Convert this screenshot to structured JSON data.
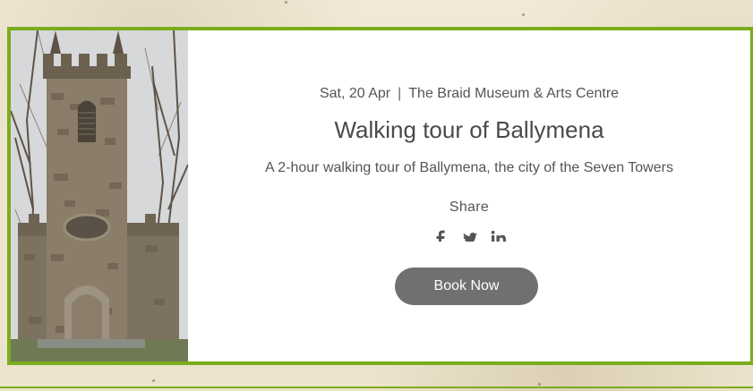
{
  "event": {
    "date": "Sat, 20 Apr",
    "separator": "|",
    "venue": "The Braid Museum & Arts Centre",
    "title": "Walking tour of Ballymena",
    "description": "A 2-hour walking tour of Ballymena, the city of the Seven Towers",
    "share_label": "Share",
    "book_button": "Book Now"
  },
  "social_icons": [
    "facebook-icon",
    "twitter-icon",
    "linkedin-icon"
  ],
  "colors": {
    "card_border": "#79ad1c",
    "button_bg": "#707070",
    "background": "#efe7d2"
  }
}
